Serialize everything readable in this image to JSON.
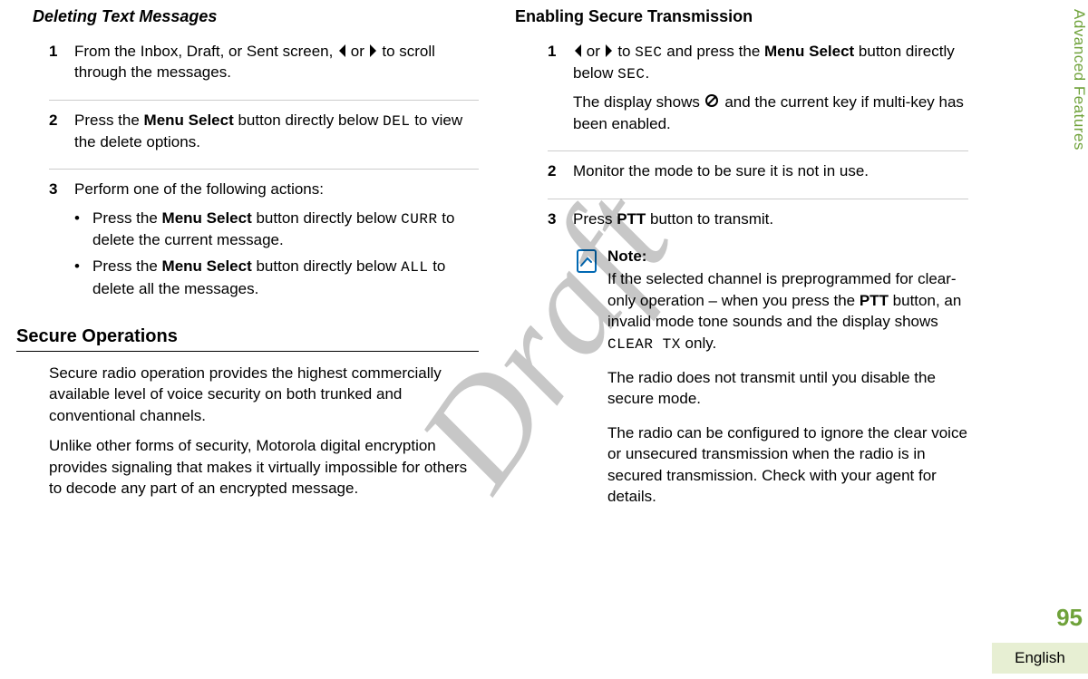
{
  "watermark": "Draft",
  "side_tab": "Advanced Features",
  "page_number": "95",
  "language": "English",
  "left": {
    "heading_delete": "Deleting Text Messages",
    "step1_a": "From the Inbox, Draft, or Sent screen, ",
    "step1_b": " or ",
    "step1_c": " to scroll through the messages.",
    "step2_a": "Press the ",
    "step2_bold": "Menu Select",
    "step2_b": " button directly below ",
    "step2_mono": "DEL",
    "step2_c": " to view the delete options.",
    "step3_intro": "Perform one of the following actions:",
    "bullet1_a": "Press the ",
    "bullet1_bold": "Menu Select",
    "bullet1_b": " button directly below ",
    "bullet1_mono": "CURR",
    "bullet1_c": " to delete the current message.",
    "bullet2_a": "Press the ",
    "bullet2_bold": "Menu Select",
    "bullet2_b": " button directly below ",
    "bullet2_mono": "ALL",
    "bullet2_c": " to delete all the messages.",
    "secure_heading": "Secure Operations",
    "secure_p1": "Secure radio operation provides the highest commercially available level of voice security on both trunked and conventional channels.",
    "secure_p2": "Unlike other forms of security, Motorola digital encryption provides signaling that makes it virtually impossible for others to decode any part of an encrypted message."
  },
  "right": {
    "heading_secure_tx": "Enabling Secure Transmission",
    "step1_b": " or ",
    "step1_c": " to ",
    "step1_mono1": "SEC",
    "step1_d": " and press the ",
    "step1_bold": "Menu Select",
    "step1_e": " button directly below ",
    "step1_mono2": "SEC",
    "step1_f": ".",
    "step1_line2a": "The display shows ",
    "step1_line2b": " and the current key if multi-key has been enabled.",
    "step2": "Monitor the mode to be sure it is not in use.",
    "step3_a": "Press ",
    "step3_bold": "PTT",
    "step3_b": " button to transmit.",
    "note_label": "Note:",
    "note_p1_a": "If the selected channel is preprogrammed for clear-only operation – when you press the ",
    "note_p1_bold": "PTT",
    "note_p1_b": " button, an invalid mode tone sounds and the display shows ",
    "note_p1_mono": "CLEAR TX",
    "note_p1_c": " only.",
    "note_p2": "The radio does not transmit until you disable the secure mode.",
    "note_p3": "The radio can be configured to ignore the clear voice or unsecured transmission when the radio is in secured transmission. Check with your agent for details."
  },
  "nums": {
    "one": "1",
    "two": "2",
    "three": "3"
  },
  "bullet_dot": "•"
}
